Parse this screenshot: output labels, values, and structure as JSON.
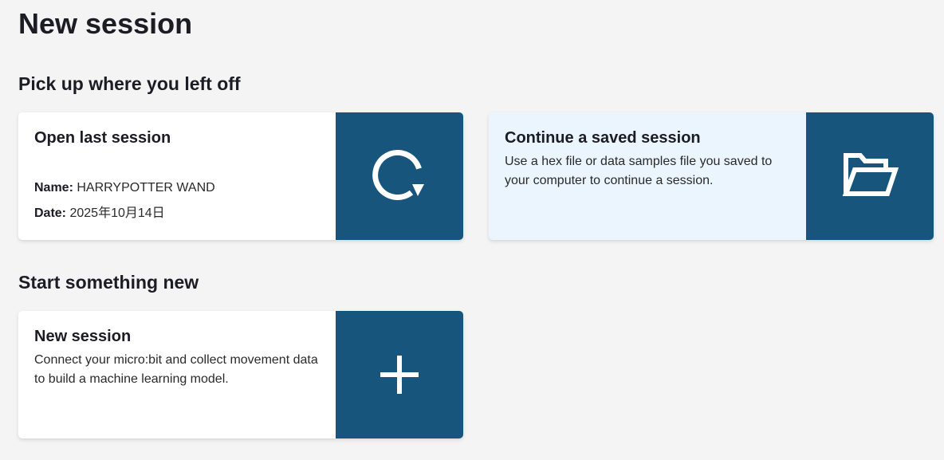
{
  "page": {
    "title": "New session"
  },
  "sections": {
    "resume_title": "Pick up where you left off",
    "new_title": "Start something new"
  },
  "cards": {
    "last_session": {
      "title": "Open last session",
      "name_label": "Name:",
      "name_value": "HARRYPOTTER WAND",
      "date_label": "Date:",
      "date_value": "2025年10月14日",
      "icon": "refresh-icon"
    },
    "saved_session": {
      "title": "Continue a saved session",
      "description": "Use a hex file or data samples file you saved to your computer to continue a session.",
      "icon": "folder-open-icon"
    },
    "new_session": {
      "title": "New session",
      "description": "Connect your micro:bit and collect movement data to build a machine learning model.",
      "icon": "plus-icon"
    }
  },
  "colors": {
    "background": "#f4f4f4",
    "icon_panel": "#17557d",
    "highlight_card": "#eaf5fd",
    "text": "#1c1c24"
  }
}
